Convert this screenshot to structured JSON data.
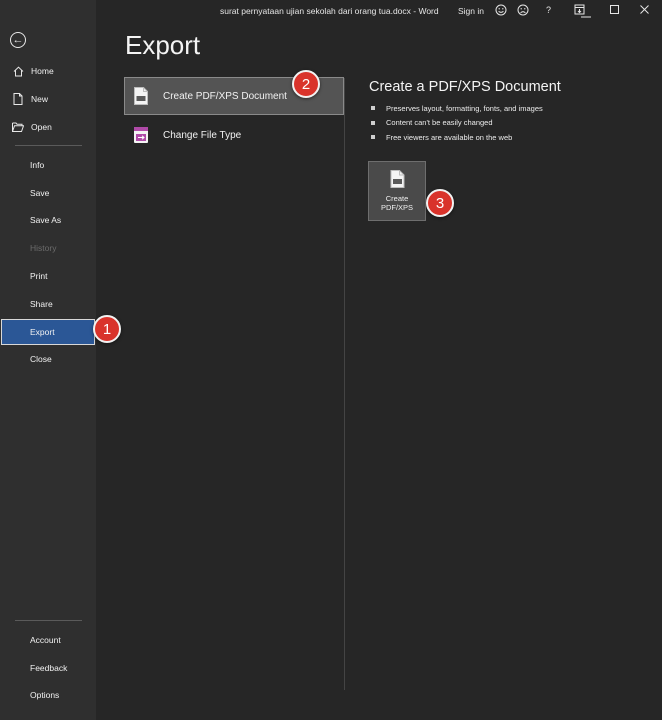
{
  "titlebar": {
    "document_title": "surat pernyataan ujian sekolah dari orang tua.docx  -  Word",
    "signin_label": "Sign in",
    "help_label": "?"
  },
  "sidebar": {
    "back_icon": "back-arrow-icon",
    "top_items": [
      {
        "label": "Home",
        "icon": "home-icon"
      },
      {
        "label": "New",
        "icon": "new-document-icon"
      },
      {
        "label": "Open",
        "icon": "folder-open-icon"
      }
    ],
    "middle_items": [
      {
        "label": "Info"
      },
      {
        "label": "Save"
      },
      {
        "label": "Save As"
      },
      {
        "label": "History",
        "disabled": true
      },
      {
        "label": "Print"
      },
      {
        "label": "Share"
      },
      {
        "label": "Export",
        "active": true
      },
      {
        "label": "Close"
      }
    ],
    "bottom_items": [
      {
        "label": "Account"
      },
      {
        "label": "Feedback"
      },
      {
        "label": "Options"
      }
    ]
  },
  "main": {
    "page_title": "Export",
    "options": [
      {
        "label": "Create PDF/XPS Document",
        "selected": true,
        "icon": "pdf-document-icon"
      },
      {
        "label": "Change File Type",
        "selected": false,
        "icon": "change-file-type-icon"
      }
    ]
  },
  "panel": {
    "title": "Create a PDF/XPS Document",
    "bullets": [
      "Preserves layout, formatting, fonts, and images",
      "Content can't be easily changed",
      "Free viewers are available on the web"
    ],
    "button_line1": "Create",
    "button_line2": "PDF/XPS"
  },
  "callouts": [
    "1",
    "2",
    "3"
  ],
  "colors": {
    "accent": "#2b5796",
    "callout": "#d9332b"
  }
}
